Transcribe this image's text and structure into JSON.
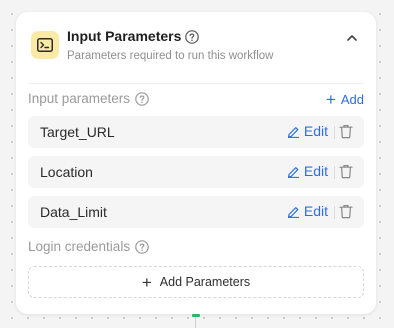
{
  "node": {
    "title": "Input Parameters",
    "subtitle": "Parameters required to run this workflow",
    "icon": "terminal-icon",
    "badge_color": "#fbe9a6"
  },
  "input_section": {
    "label": "Input parameters",
    "add_label": "Add"
  },
  "parameters": [
    {
      "name": "Target_URL",
      "edit_label": "Edit"
    },
    {
      "name": "Location",
      "edit_label": "Edit"
    },
    {
      "name": "Data_Limit",
      "edit_label": "Edit"
    }
  ],
  "login_section": {
    "label": "Login credentials"
  },
  "add_parameters_label": "Add Parameters",
  "colors": {
    "accent": "#2d6fe0",
    "connector": "#2fb56a"
  }
}
